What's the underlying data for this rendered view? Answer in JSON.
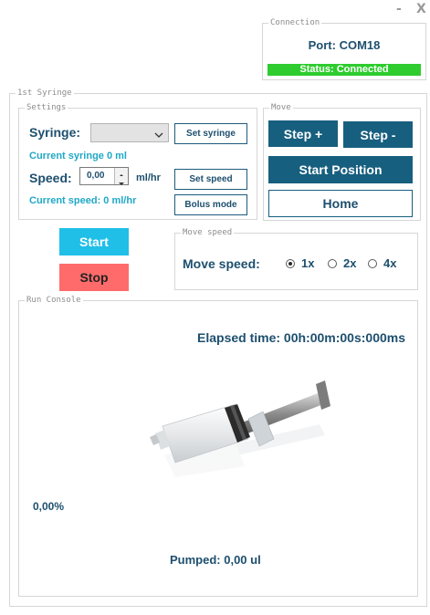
{
  "window": {
    "minimize": "-",
    "close": "X"
  },
  "connection": {
    "legend": "Connection",
    "port": "Port: COM18",
    "status": "Status: Connected",
    "status_color": "#2ecc2e"
  },
  "syringe_panel": {
    "legend": "1st Syringe"
  },
  "settings": {
    "legend": "Settings",
    "syringe_label": "Syringe:",
    "syringe_selected": "",
    "set_syringe": "Set syringe",
    "current_syringe": "Current syringe 0 ml",
    "speed_label": "Speed:",
    "speed_value": "0,00",
    "speed_unit": "ml/hr",
    "set_speed": "Set speed",
    "current_speed": "Current speed: 0 ml/hr",
    "bolus_mode": "Bolus mode"
  },
  "move": {
    "legend": "Move",
    "step_plus": "Step +",
    "step_minus": "Step -",
    "start_position": "Start Position",
    "home": "Home"
  },
  "actions": {
    "start": "Start",
    "start_color": "#1fbfe8",
    "stop": "Stop",
    "stop_color": "#ff6b6b"
  },
  "move_speed": {
    "legend": "Move speed",
    "label": "Move speed:",
    "options": [
      "1x",
      "2x",
      "4x"
    ],
    "selected": "1x"
  },
  "console": {
    "legend": "Run Console",
    "elapsed": "Elapsed time: 00h:00m:00s:000ms",
    "progress": "0,00%",
    "progress_value": 0,
    "pumped": "Pumped: 0,00 ul"
  }
}
